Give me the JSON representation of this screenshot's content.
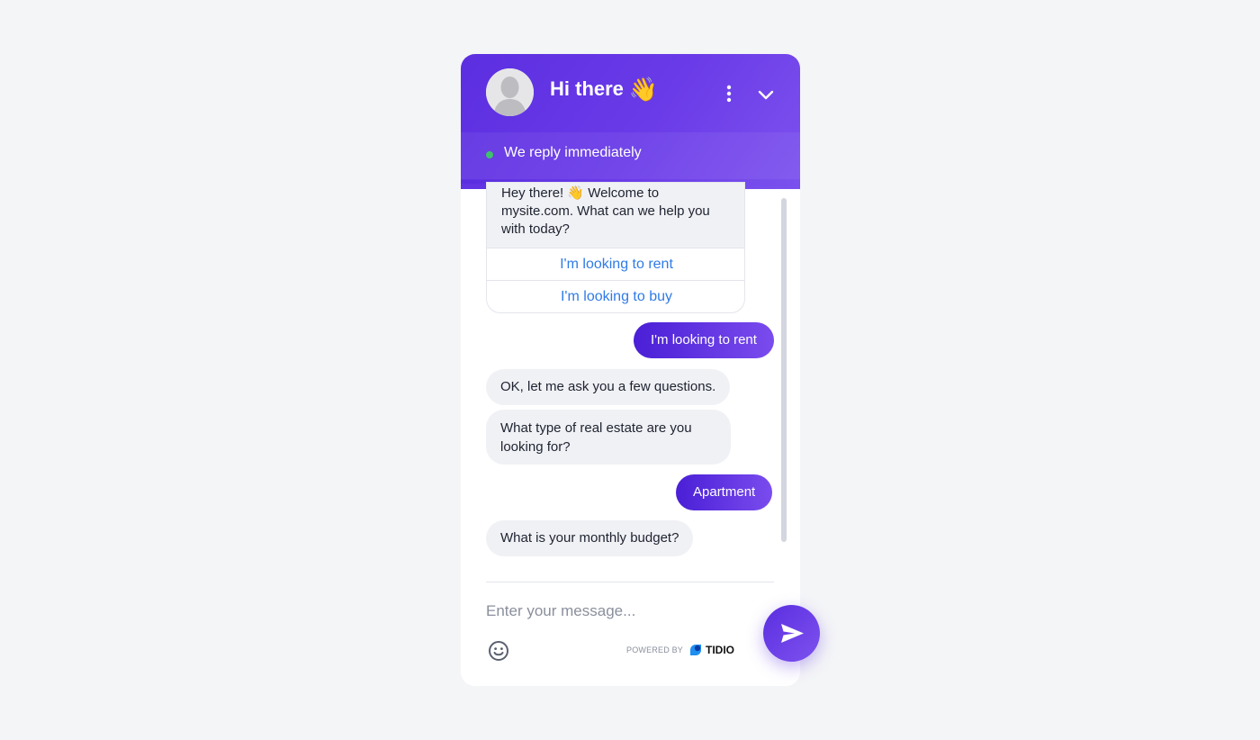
{
  "header": {
    "title": "Hi there",
    "title_emoji": "👋",
    "avatar_icon": "default-user-avatar",
    "menu_icon": "kebab-menu-icon",
    "collapse_icon": "chevron-down-icon",
    "status_text": "We reply immediately",
    "status_color": "#3ec26b"
  },
  "messages": {
    "welcome": {
      "line1": "Hey there! ",
      "emoji": "👋",
      "line1_rest": " Welcome to",
      "line2": "mysite.com. What can we help you",
      "line3": "with today?",
      "options": [
        "I'm looking to rent",
        "I'm looking to buy"
      ]
    },
    "user_1": "I'm looking to rent",
    "bot_1": "OK, let me ask you a few questions.",
    "bot_2_line1": "What type of real estate are you",
    "bot_2_line2": "looking for?",
    "user_2": "Apartment",
    "bot_3": "What is your monthly budget?"
  },
  "composer": {
    "placeholder": "Enter your message...",
    "emoji_icon": "smiley-icon",
    "powered_label": "POWERED BY",
    "brand": "TIDIO",
    "send_icon": "paper-plane-icon"
  },
  "colors": {
    "accent": "#5b2ee0",
    "accent_light": "#7d52ee",
    "link": "#2f7be6",
    "bot_bubble": "#f0f1f5"
  }
}
